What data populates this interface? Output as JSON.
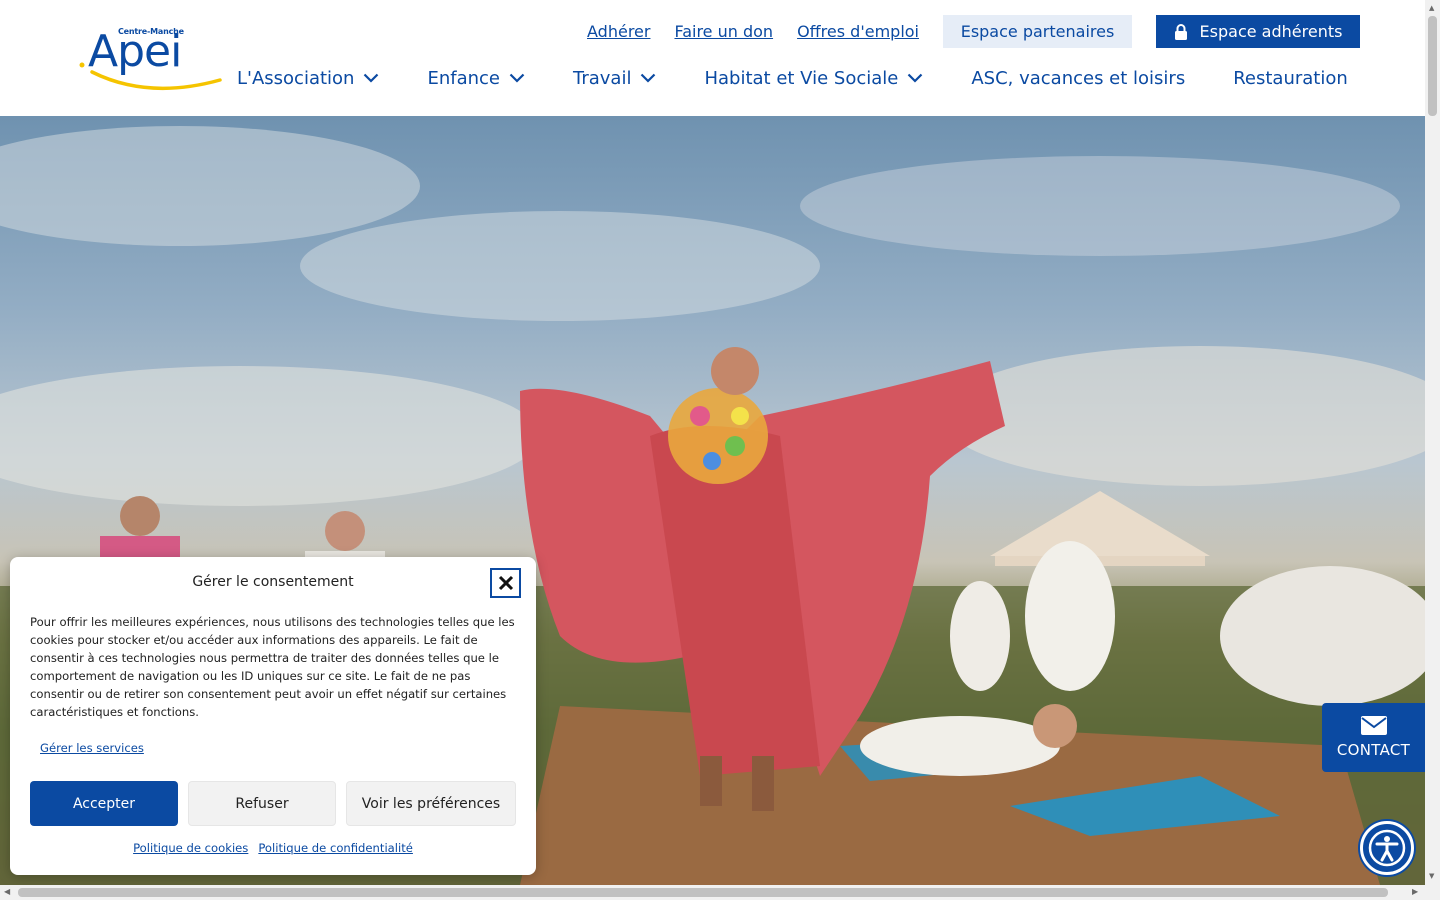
{
  "brand": {
    "logo_top": "Centre-Manche",
    "logo_main": "Apei",
    "primary": "#0b4aa2",
    "accent_yellow": "#f5c400"
  },
  "top_links": [
    "Adhérer",
    "Faire un don",
    "Offres d'emploi"
  ],
  "partners_label": "Espace partenaires",
  "members_label": "Espace adhérents",
  "nav": [
    {
      "label": "L'Association",
      "has_dropdown": true
    },
    {
      "label": "Enfance",
      "has_dropdown": true
    },
    {
      "label": "Travail",
      "has_dropdown": true
    },
    {
      "label": "Habitat et Vie Sociale",
      "has_dropdown": true
    },
    {
      "label": "ASC, vacances et loisirs",
      "has_dropdown": false
    },
    {
      "label": "Restauration",
      "has_dropdown": false
    }
  ],
  "consent": {
    "title": "Gérer le consentement",
    "body": "Pour offrir les meilleures expériences, nous utilisons des technologies telles que les cookies pour stocker et/ou accéder aux informations des appareils. Le fait de consentir à ces technologies nous permettra de traiter des données telles que le comportement de navigation ou les ID uniques sur ce site. Le fait de ne pas consentir ou de retirer son consentement peut avoir un effet négatif sur certaines caractéristiques et fonctions.",
    "manage_services": "Gérer les services",
    "accept": "Accepter",
    "refuse": "Refuser",
    "preferences": "Voir les préférences",
    "cookie_policy": "Politique de cookies",
    "privacy_policy": "Politique de confidentialité"
  },
  "contact_label": "CONTACT",
  "icons": {
    "lock": "lock-icon",
    "chevron": "chevron-down-icon",
    "close": "close-icon",
    "mail": "mail-icon",
    "accessibility": "accessibility-icon"
  }
}
